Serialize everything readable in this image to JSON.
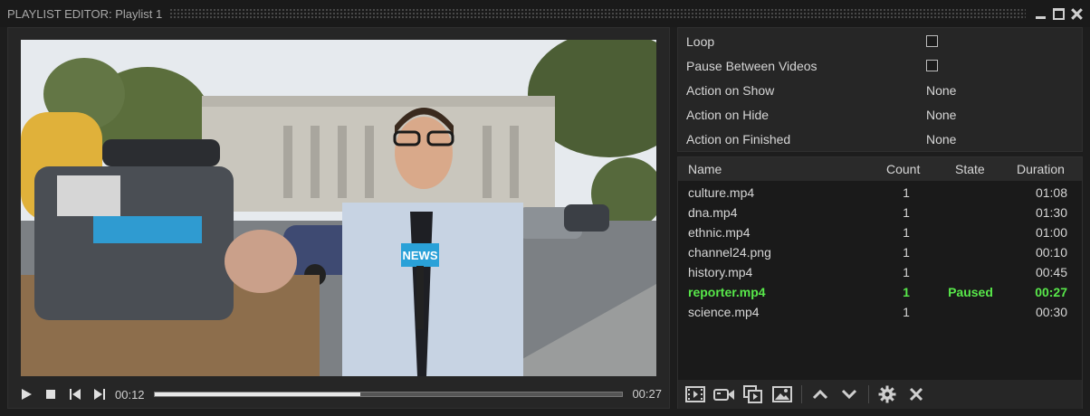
{
  "window": {
    "title": "PLAYLIST EDITOR: Playlist 1"
  },
  "player": {
    "current_time": "00:12",
    "end_time": "00:27",
    "progress": 0.44,
    "overlay_text": "NEWS"
  },
  "properties": [
    {
      "label": "Loop",
      "type": "checkbox",
      "checked": false
    },
    {
      "label": "Pause Between Videos",
      "type": "checkbox",
      "checked": false
    },
    {
      "label": "Action on Show",
      "type": "value",
      "value": "None"
    },
    {
      "label": "Action on Hide",
      "type": "value",
      "value": "None"
    },
    {
      "label": "Action on Finished",
      "type": "value",
      "value": "None"
    }
  ],
  "playlist": {
    "columns": {
      "name": "Name",
      "count": "Count",
      "state": "State",
      "duration": "Duration"
    },
    "items": [
      {
        "name": "culture.mp4",
        "count": "1",
        "state": "",
        "duration": "01:08"
      },
      {
        "name": "dna.mp4",
        "count": "1",
        "state": "",
        "duration": "01:30"
      },
      {
        "name": "ethnic.mp4",
        "count": "1",
        "state": "",
        "duration": "01:00"
      },
      {
        "name": "channel24.png",
        "count": "1",
        "state": "",
        "duration": "00:10"
      },
      {
        "name": "history.mp4",
        "count": "1",
        "state": "",
        "duration": "00:45"
      },
      {
        "name": "reporter.mp4",
        "count": "1",
        "state": "Paused",
        "duration": "00:27",
        "active": true
      },
      {
        "name": "science.mp4",
        "count": "1",
        "state": "",
        "duration": "00:30"
      }
    ]
  },
  "toolbar": {
    "icons": [
      "add-video-icon",
      "add-camera-icon",
      "add-clip-icon",
      "add-image-icon",
      "move-up-icon",
      "move-down-icon",
      "settings-icon",
      "remove-icon"
    ]
  },
  "colors": {
    "background": "#1d1d1d",
    "panel": "#262626",
    "active_item": "#58e84a"
  }
}
